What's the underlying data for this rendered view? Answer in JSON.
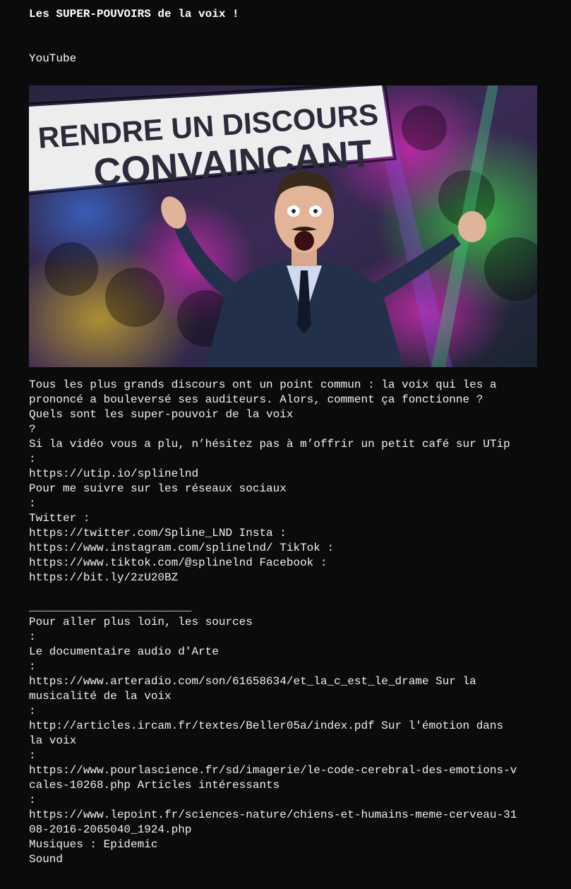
{
  "post": {
    "title": "Les SUPER-POUVOIRS de la voix !",
    "source": "YouTube"
  },
  "thumbnail": {
    "line1": "RENDRE UN DISCOURS",
    "line2": "CONVAINCANT",
    "colors": {
      "banner_bg": "#ffffff",
      "banner_text": "#2b2b3c",
      "suit": "#23304a"
    }
  },
  "description": {
    "lines": [
      "Tous les plus grands discours ont un point commun : la voix qui les a",
      "prononcé a bouleversé ses auditeurs. Alors, comment ça fonctionne ?",
      "Quels sont les super-pouvoir de la voix",
      "?",
      "Si la vidéo vous a plu, n’hésitez pas à m’offrir un petit café sur UTip",
      ":",
      "https://utip.io/splinelnd",
      "Pour me suivre sur les réseaux sociaux",
      ":",
      "Twitter :",
      "https://twitter.com/Spline_LND Insta :",
      "https://www.instagram.com/splinelnd/ TikTok :",
      "https://www.tiktok.com/@splinelnd Facebook :",
      "https://bit.ly/2zU20BZ",
      "",
      "________________________",
      "Pour aller plus loin, les sources",
      ":",
      "Le documentaire audio d'Arte",
      ":",
      "https://www.arteradio.com/son/61658634/et_la_c_est_le_drame Sur la",
      "musicalité de la voix",
      ":",
      "http://articles.ircam.fr/textes/Beller05a/index.pdf Sur l'émotion dans",
      "la voix",
      ":",
      "https://www.pourlascience.fr/sd/imagerie/le-code-cerebral-des-emotions-v",
      "cales-10268.php Articles intéressants",
      ":",
      "https://www.lepoint.fr/sciences-nature/chiens-et-humains-meme-cerveau-31",
      "08-2016-2065040_1924.php",
      "Musiques : Epidemic",
      "Sound"
    ]
  }
}
